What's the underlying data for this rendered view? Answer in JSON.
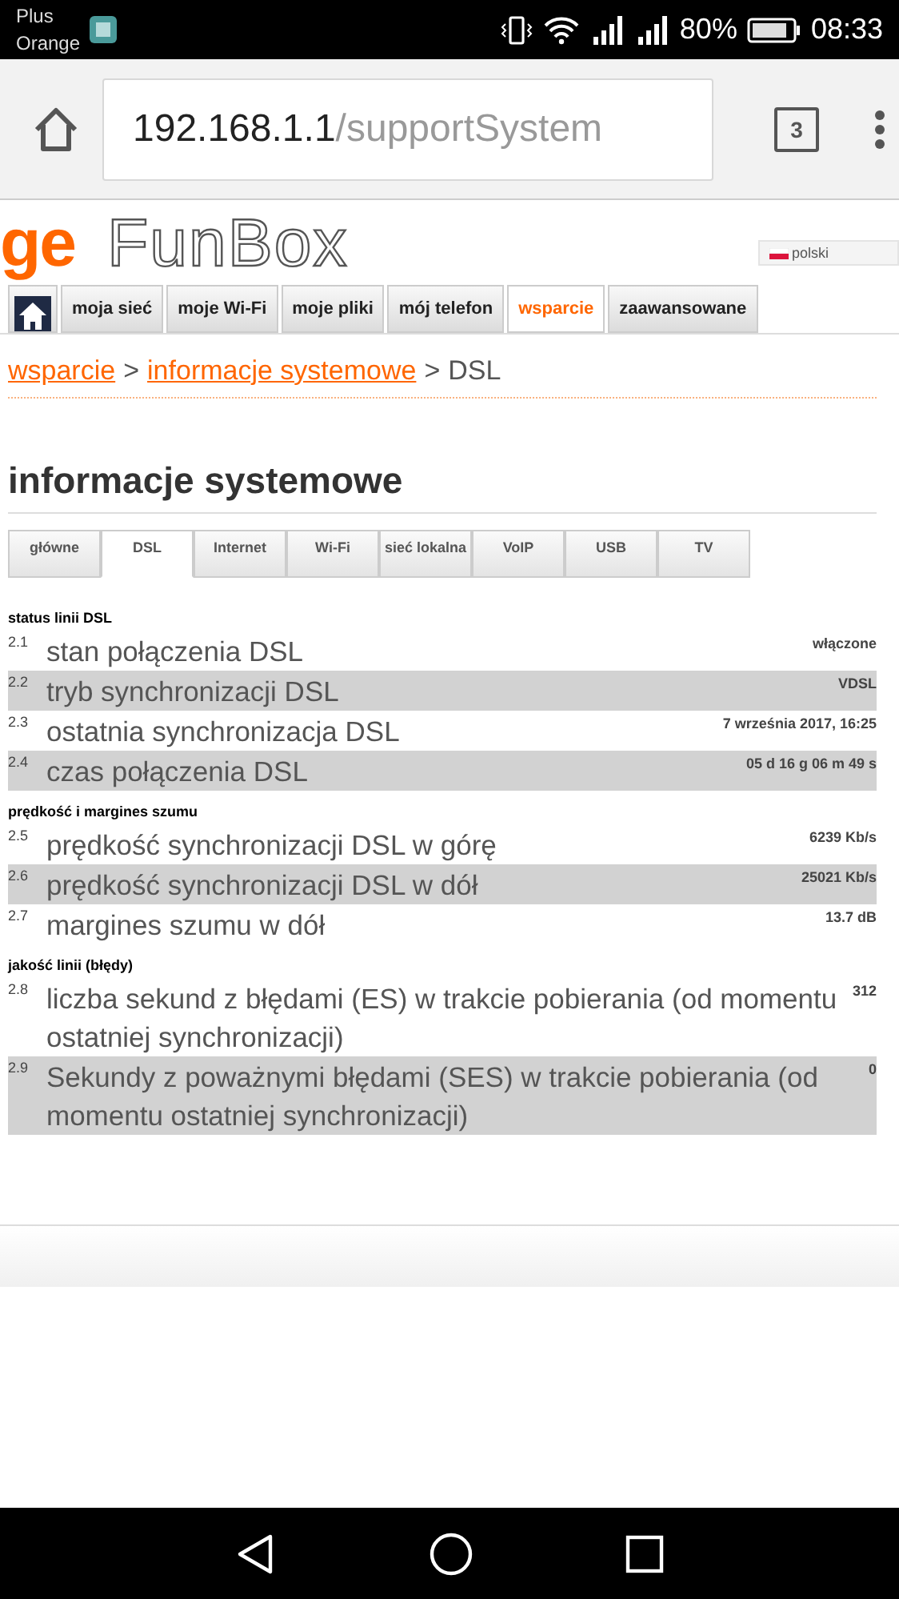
{
  "status_bar": {
    "carrier": [
      "Plus",
      "Orange"
    ],
    "battery": "80%",
    "time": "08:33"
  },
  "browser": {
    "url_host": "192.168.1.1",
    "url_path": "/supportSystem",
    "tab_count": "3"
  },
  "header": {
    "logo_brand": "ge",
    "logo_product": "FunBox",
    "language": "polski"
  },
  "nav": [
    {
      "label": "moja sieć",
      "selected": false
    },
    {
      "label": "moje Wi-Fi",
      "selected": false
    },
    {
      "label": "moje pliki",
      "selected": false
    },
    {
      "label": "mój telefon",
      "selected": false
    },
    {
      "label": "wsparcie",
      "selected": true
    },
    {
      "label": "zaawansowane",
      "selected": false
    }
  ],
  "breadcrumb": {
    "separator": ">",
    "items": [
      {
        "label": "wsparcie",
        "kind": "link"
      },
      {
        "label": "informacje systemowe",
        "kind": "link"
      },
      {
        "label": "DSL",
        "kind": "current"
      }
    ]
  },
  "page_title": "informacje systemowe",
  "subtabs": [
    {
      "label": "główne",
      "selected": false
    },
    {
      "label": "DSL",
      "selected": true
    },
    {
      "label": "Internet",
      "selected": false
    },
    {
      "label": "Wi-Fi",
      "selected": false
    },
    {
      "label": "sieć lokalna",
      "selected": false
    },
    {
      "label": "VoIP",
      "selected": false
    },
    {
      "label": "USB",
      "selected": false
    },
    {
      "label": "TV",
      "selected": false
    }
  ],
  "sections": [
    {
      "title": "status linii DSL",
      "rows": [
        {
          "number": "2.1",
          "label": "stan połączenia DSL",
          "value": "włączone",
          "shaded": false
        },
        {
          "number": "2.2",
          "label": "tryb synchronizacji DSL",
          "value": "VDSL",
          "shaded": true
        },
        {
          "number": "2.3",
          "label": "ostatnia synchronizacja DSL",
          "value": "7 września 2017, 16:25",
          "shaded": false
        },
        {
          "number": "2.4",
          "label": "czas połączenia DSL",
          "value": "05 d 16 g 06 m 49 s",
          "shaded": true
        }
      ]
    },
    {
      "title": "prędkość i margines szumu",
      "rows": [
        {
          "number": "2.5",
          "label": "prędkość synchronizacji DSL w górę",
          "value": "6239 Kb/s",
          "shaded": false
        },
        {
          "number": "2.6",
          "label": "prędkość synchronizacji DSL w dół",
          "value": "25021 Kb/s",
          "shaded": true
        },
        {
          "number": "2.7",
          "label": "margines szumu w dół",
          "value": "13.7 dB",
          "shaded": false
        }
      ]
    },
    {
      "title": "jakość linii (błędy)",
      "rows": [
        {
          "number": "2.8",
          "label": "liczba sekund z błędami (ES) w trakcie pobierania (od momentu ostatniej synchronizacji)",
          "value": "312",
          "shaded": false
        },
        {
          "number": "2.9",
          "label": "Sekundy z poważnymi błędami (SES) w trakcie pobierania (od momentu ostatniej synchronizacji)",
          "value": "0",
          "shaded": true
        }
      ]
    }
  ]
}
